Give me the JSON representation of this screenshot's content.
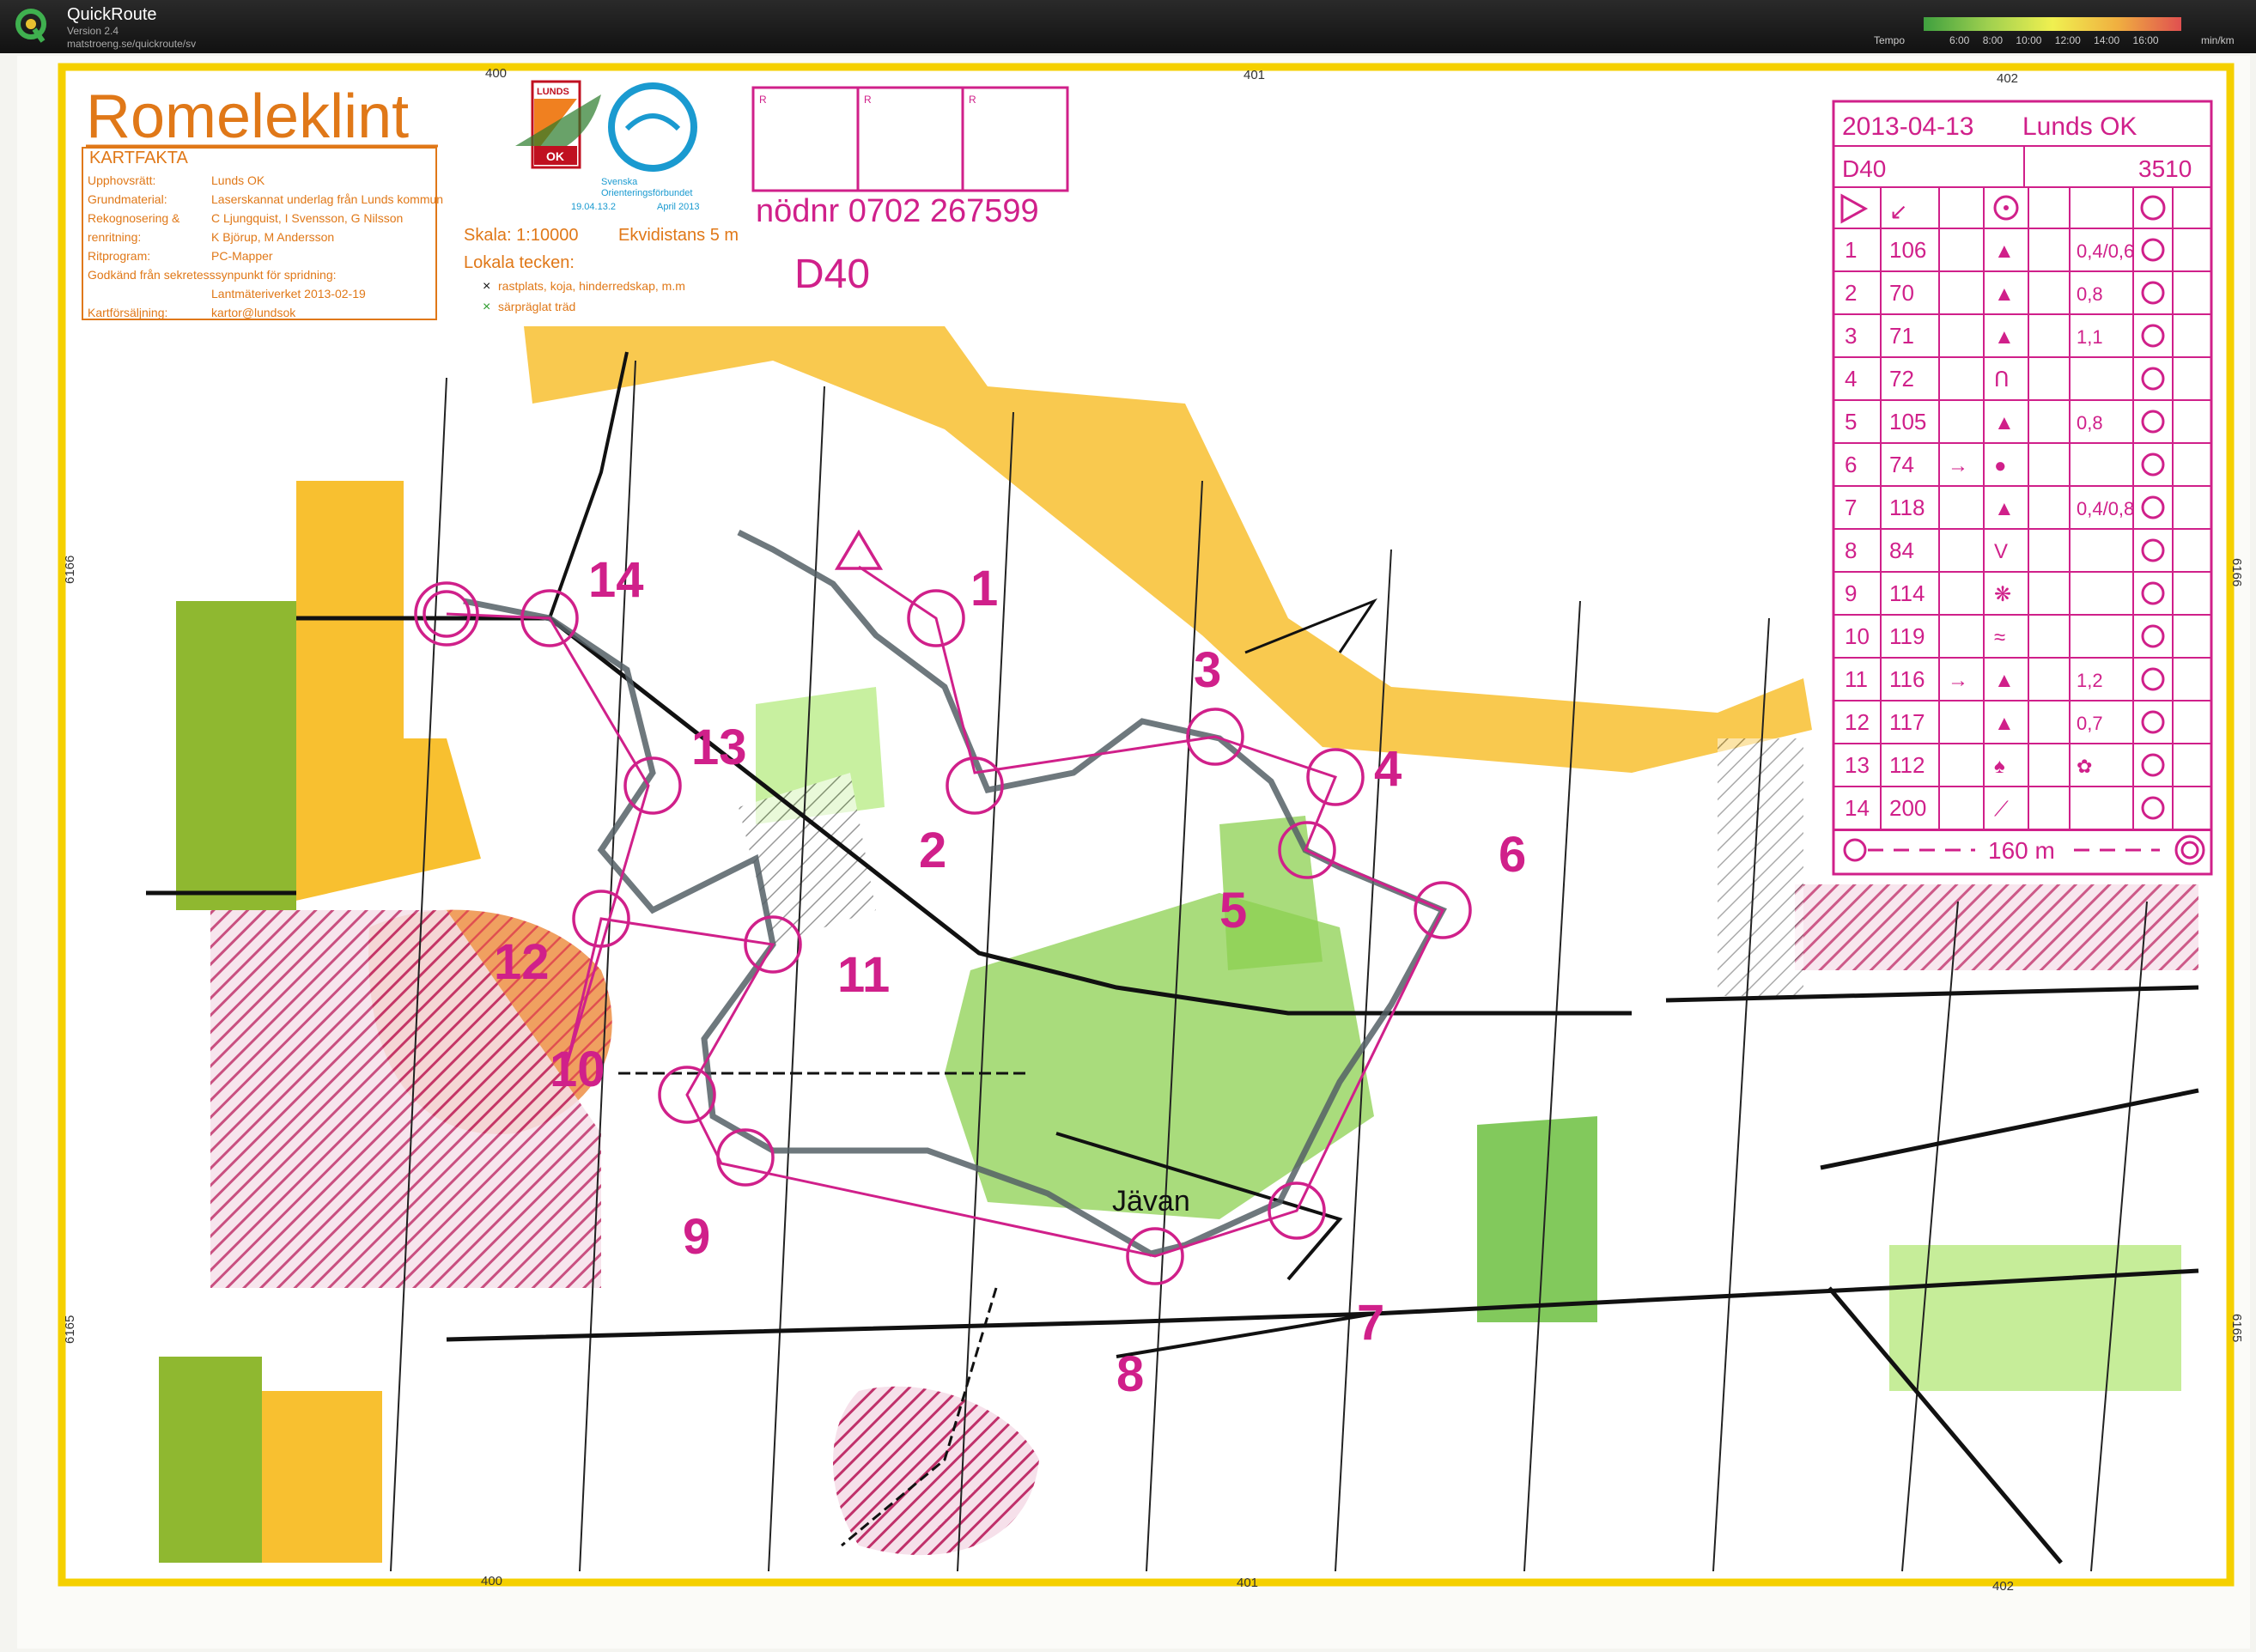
{
  "app": {
    "title": "QuickRoute",
    "version": "Version 2.4",
    "url": "matstroeng.se/quickroute/sv"
  },
  "tempo": {
    "label": "Tempo",
    "ticks": [
      "6:00",
      "8:00",
      "10:00",
      "12:00",
      "14:00",
      "16:00"
    ],
    "unit": "min/km"
  },
  "map": {
    "title": "Romeleklint",
    "kartfakta": {
      "heading": "KARTFAKTA",
      "rows": [
        {
          "key": "Upphovsrätt:",
          "value": "Lunds OK"
        },
        {
          "key": "Grundmaterial:",
          "value": "Laserskannat underlag från Lunds kommun"
        },
        {
          "key": "Rekognosering &",
          "value": "C Ljungquist, I Svensson, G Nilsson"
        },
        {
          "key": "renritning:",
          "value": "K Björup, M Andersson"
        },
        {
          "key": "Ritprogram:",
          "value": "PC-Mapper"
        },
        {
          "key": "Godkänd från sekretesssynpunkt för spridning:",
          "value": ""
        },
        {
          "key": "",
          "value": "Lantmäteriverket 2013-02-19"
        },
        {
          "key": "Kartförsäljning:",
          "value": "kartor@lundsok"
        }
      ]
    },
    "club_logo": {
      "line1": "LUNDS",
      "line2": "OK"
    },
    "federation_logo": {
      "line1": "Svenska",
      "line2": "Orienteringsförbundet",
      "left": "19.04.13.2",
      "right": "April 2013"
    },
    "scale": "Skala: 1:10000",
    "contour": "Ekvidistans 5 m",
    "local_symbols": {
      "heading": "Lokala tecken:",
      "items": [
        {
          "mark": "×",
          "text": "rastplats, koja, hinderredskap, m.m",
          "color": "#111111"
        },
        {
          "mark": "×",
          "text": "särpräglat träd",
          "color": "#2a9a2a"
        }
      ]
    },
    "emergency": "nödnr 0702 267599",
    "class_label": "D40",
    "punch_boxes": [
      "R",
      "R",
      "R"
    ],
    "grid_labels": {
      "top": [
        "400",
        "401",
        "402"
      ],
      "bottom": [
        "400",
        "401",
        "402"
      ],
      "left": [
        "6166",
        "6165"
      ],
      "right": [
        "6166",
        "6165"
      ]
    },
    "place_name": "Jävan",
    "control_numbers": [
      "1",
      "2",
      "3",
      "4",
      "5",
      "6",
      "7",
      "8",
      "9",
      "10",
      "11",
      "12",
      "13",
      "14"
    ]
  },
  "description_sheet": {
    "date": "2013-04-13",
    "club": "Lunds OK",
    "class": "D40",
    "length": "3510",
    "controls": [
      {
        "num": "1",
        "code": "106",
        "dir": "",
        "feature": "▲",
        "dim": "0,4/0,6"
      },
      {
        "num": "2",
        "code": "70",
        "dir": "",
        "feature": "▲",
        "dim": "0,8"
      },
      {
        "num": "3",
        "code": "71",
        "dir": "",
        "feature": "▲",
        "dim": "1,1"
      },
      {
        "num": "4",
        "code": "72",
        "dir": "",
        "feature": "ꓵ",
        "dim": ""
      },
      {
        "num": "5",
        "code": "105",
        "dir": "",
        "feature": "▲",
        "dim": "0,8"
      },
      {
        "num": "6",
        "code": "74",
        "dir": "→",
        "feature": "●",
        "dim": ""
      },
      {
        "num": "7",
        "code": "118",
        "dir": "",
        "feature": "▲",
        "dim": "0,4/0,8"
      },
      {
        "num": "8",
        "code": "84",
        "dir": "",
        "feature": "V",
        "dim": ""
      },
      {
        "num": "9",
        "code": "114",
        "dir": "",
        "feature": "❋",
        "dim": ""
      },
      {
        "num": "10",
        "code": "119",
        "dir": "",
        "feature": "≈",
        "dim": ""
      },
      {
        "num": "11",
        "code": "116",
        "dir": "→",
        "feature": "▲",
        "dim": "1,2"
      },
      {
        "num": "12",
        "code": "117",
        "dir": "",
        "feature": "▲",
        "dim": "0,7"
      },
      {
        "num": "13",
        "code": "112",
        "dir": "",
        "feature": "♠",
        "dim": "✿"
      },
      {
        "num": "14",
        "code": "200",
        "dir": "",
        "feature": "⟋",
        "dim": ""
      }
    ],
    "finish": "160 m"
  }
}
